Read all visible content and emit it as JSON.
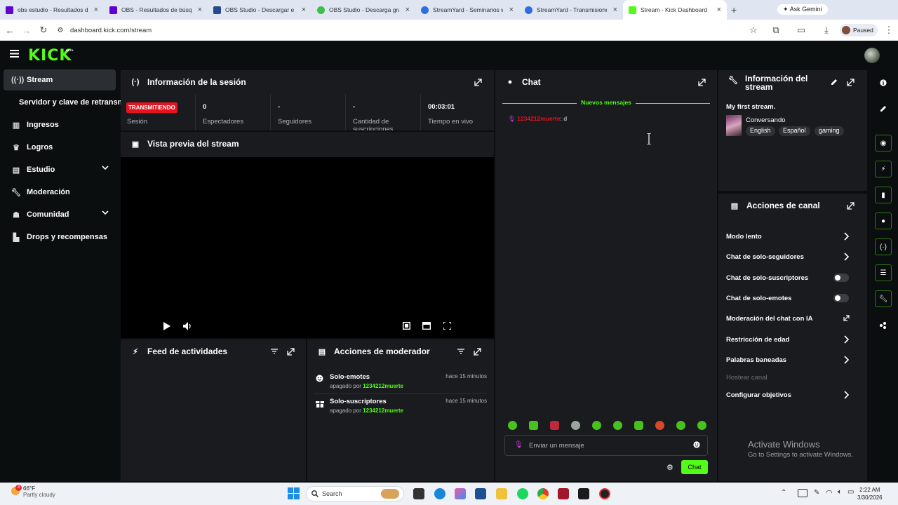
{
  "browser": {
    "tabs": [
      {
        "title": "obs estudio - Resultados de",
        "color": "#6001d2"
      },
      {
        "title": "OBS - Resultados de búsque",
        "color": "#6001d2"
      },
      {
        "title": "OBS Studio - Descargar e ins",
        "color": "#284a8f"
      },
      {
        "title": "OBS Studio - Descarga gratu",
        "color": "#3bbf45"
      },
      {
        "title": "StreamYard - Seminarios web",
        "color": "#2f6de1"
      },
      {
        "title": "StreamYard - Transmisione",
        "color": "#2f6de1"
      },
      {
        "title": "Stream - Kick Dashboard",
        "color": "#53fc18"
      }
    ],
    "gemini_label": "Ask Gemini",
    "url": "dashboard.kick.com/stream",
    "profile_status": "Paused"
  },
  "kick": {
    "logo": "KICK",
    "beta": "BETA"
  },
  "sidebar": {
    "items": [
      {
        "label": "Stream",
        "icon": "broadcast-icon"
      },
      {
        "label": "Servidor y clave de retransmisión",
        "icon": ""
      },
      {
        "label": "Ingresos",
        "icon": "chart-icon"
      },
      {
        "label": "Logros",
        "icon": "trophy-icon"
      },
      {
        "label": "Estudio",
        "icon": "studio-icon"
      },
      {
        "label": "Moderación",
        "icon": "wrench-icon"
      },
      {
        "label": "Comunidad",
        "icon": "community-icon"
      },
      {
        "label": "Drops y recompensas",
        "icon": "gift-icon"
      }
    ]
  },
  "session": {
    "title": "Información de la sesión",
    "badge": "TRANSMITIENDO",
    "session_label": "Sesión",
    "stats": [
      {
        "value": "0",
        "label": "Espectadores"
      },
      {
        "value": "-",
        "label": "Seguidores"
      },
      {
        "value": "-",
        "label": "Cantidad de suscripciones"
      },
      {
        "value": "00:03:01",
        "label": "Tiempo en vivo"
      }
    ]
  },
  "preview": {
    "title": "Vista previa del stream"
  },
  "feed": {
    "title": "Feed de actividades"
  },
  "modactions": {
    "title": "Acciones de moderador",
    "items": [
      {
        "title": "Solo-emotes",
        "by_prefix": "apagado por",
        "user": "1234212muerte",
        "time": "hace 15 minutos"
      },
      {
        "title": "Solo-suscriptores",
        "by_prefix": "apagado por",
        "user": "1234212muerte",
        "time": "hace 15 minutos"
      }
    ]
  },
  "chat": {
    "title": "Chat",
    "new_messages": "Nuevos mensajes",
    "message": {
      "user": "1234212muerte",
      "text": ": d"
    },
    "input_placeholder": "Enviar un mensaje",
    "send_label": "Chat"
  },
  "streaminfo": {
    "title": "Información del stream",
    "stream_title": "My first stream.",
    "category": "Conversando",
    "tags": [
      "English",
      "Español",
      "gaming"
    ]
  },
  "channel_actions": {
    "title": "Acciones de canal",
    "items": [
      {
        "label": "Modo lento",
        "control": "arrow"
      },
      {
        "label": "Chat de solo-seguidores",
        "control": "arrow"
      },
      {
        "label": "Chat de solo-suscriptores",
        "control": "toggle",
        "on": false
      },
      {
        "label": "Chat de solo-emotes",
        "control": "toggle",
        "on": false
      },
      {
        "label": "Moderación del chat con IA",
        "control": "external"
      },
      {
        "label": "Restricción de edad",
        "control": "arrow"
      },
      {
        "label": "Palabras baneadas",
        "control": "arrow"
      },
      {
        "label": "Hostear canal",
        "control": "disabled"
      },
      {
        "label": "Configurar objetivos",
        "control": "arrow"
      }
    ]
  },
  "watermark": {
    "line1": "Activate Windows",
    "line2": "Go to Settings to activate Windows."
  },
  "taskbar": {
    "temp": "66°F",
    "weather": "Partly cloudy",
    "notif_count": "3",
    "search": "Search",
    "time": "2:22 AM",
    "date": "3/30/2026"
  },
  "colors": {
    "accent": "#53fc18",
    "live": "#e4131f",
    "panel": "#191b1f"
  }
}
